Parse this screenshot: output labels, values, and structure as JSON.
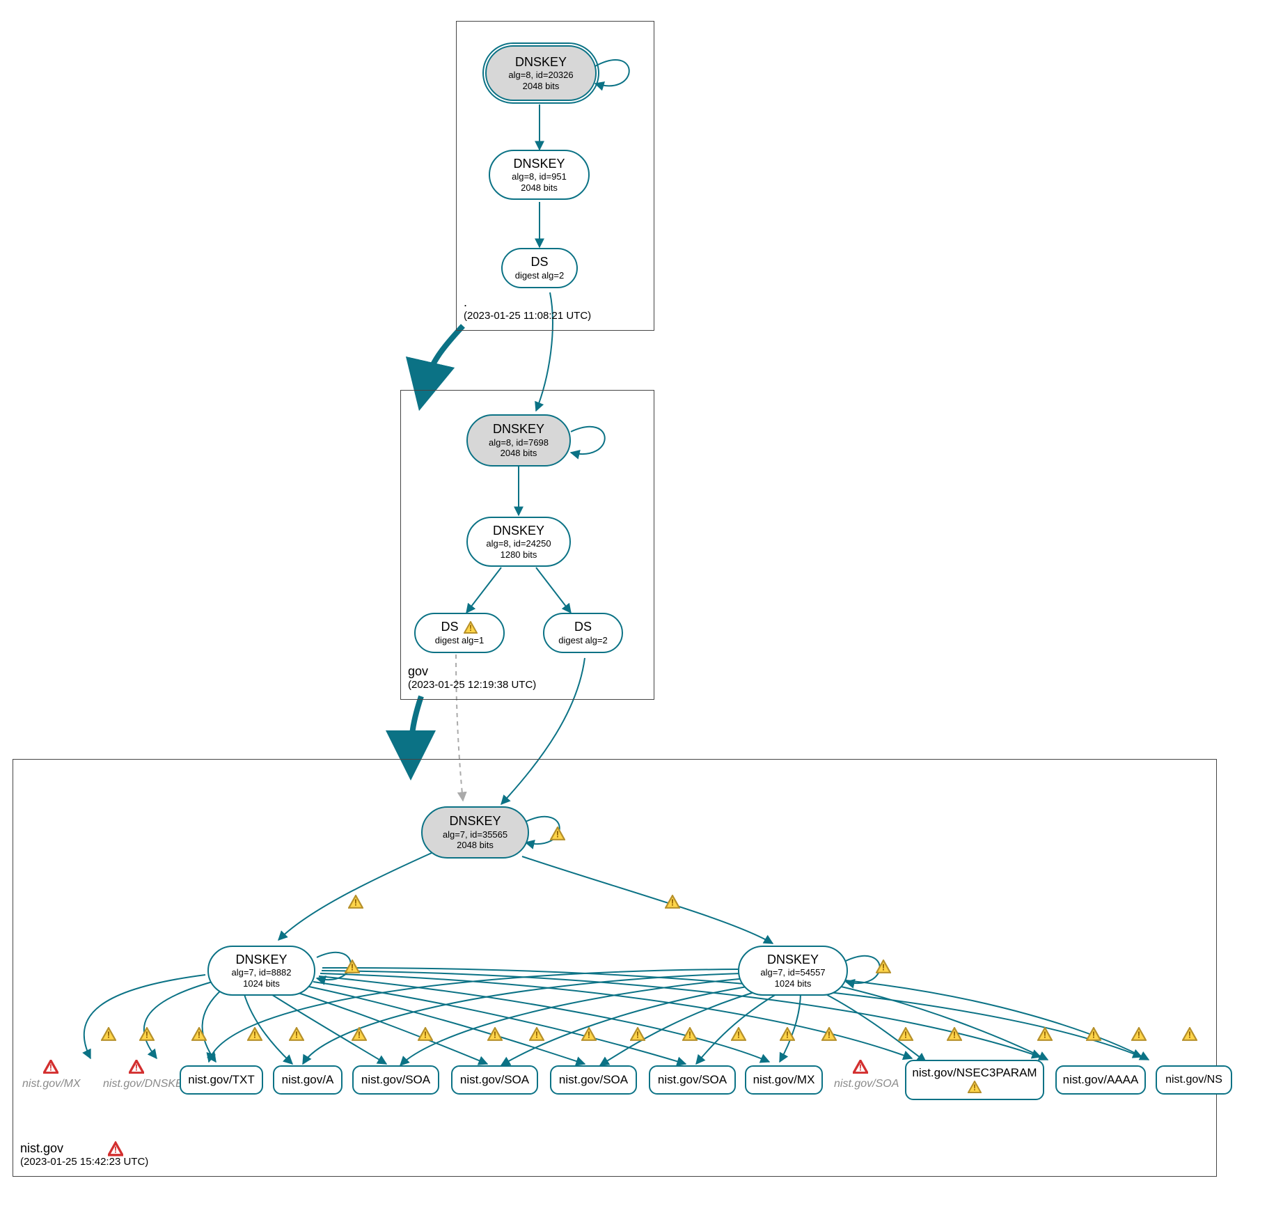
{
  "zones": {
    "root": {
      "name": ".",
      "timestamp": "(2023-01-25 11:08:21 UTC)",
      "nodes": {
        "ksk": {
          "title": "DNSKEY",
          "line2": "alg=8, id=20326",
          "line3": "2048 bits"
        },
        "zsk": {
          "title": "DNSKEY",
          "line2": "alg=8, id=951",
          "line3": "2048 bits"
        },
        "ds": {
          "title": "DS",
          "line2": "digest alg=2"
        }
      }
    },
    "gov": {
      "name": "gov",
      "timestamp": "(2023-01-25 12:19:38 UTC)",
      "nodes": {
        "ksk": {
          "title": "DNSKEY",
          "line2": "alg=8, id=7698",
          "line3": "2048 bits"
        },
        "zsk": {
          "title": "DNSKEY",
          "line2": "alg=8, id=24250",
          "line3": "1280 bits"
        },
        "ds1": {
          "title": "DS",
          "line2": "digest alg=1"
        },
        "ds2": {
          "title": "DS",
          "line2": "digest alg=2"
        }
      }
    },
    "nist": {
      "name": "nist.gov",
      "timestamp": "(2023-01-25 15:42:23 UTC)",
      "nodes": {
        "ksk": {
          "title": "DNSKEY",
          "line2": "alg=7, id=35565",
          "line3": "2048 bits"
        },
        "zsk1": {
          "title": "DNSKEY",
          "line2": "alg=7, id=8882",
          "line3": "1024 bits"
        },
        "zsk2": {
          "title": "DNSKEY",
          "line2": "alg=7, id=54557",
          "line3": "1024 bits"
        }
      },
      "rrsets": {
        "txt": "nist.gov/TXT",
        "a": "nist.gov/A",
        "soa1": "nist.gov/SOA",
        "soa2": "nist.gov/SOA",
        "soa3": "nist.gov/SOA",
        "soa4": "nist.gov/SOA",
        "mx": "nist.gov/MX",
        "nsec3": "nist.gov/NSEC3PARAM",
        "aaaa": "nist.gov/AAAA",
        "ns": "nist.gov/NS"
      },
      "gray_rrsets": {
        "gmx": "nist.gov/MX",
        "gdnskey": "nist.gov/DNSKEY",
        "gsoa": "nist.gov/SOA"
      }
    }
  }
}
